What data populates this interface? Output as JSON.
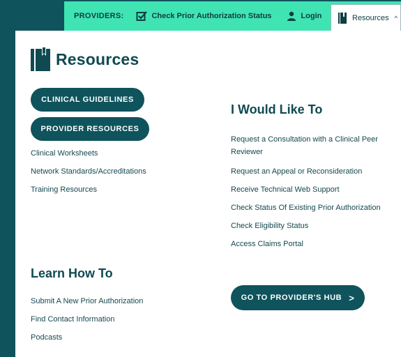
{
  "topbar": {
    "providers_label": "PROVIDERS:",
    "status_link": "Check Prior Authorization Status",
    "login_link": "Login",
    "resources_tab": "Resources",
    "resources_chevron": "^"
  },
  "panel": {
    "title": "Resources",
    "buttons": {
      "clinical_guidelines": "CLINICAL GUIDELINES",
      "provider_resources": "PROVIDER RESOURCES"
    },
    "resource_links": [
      "Clinical Worksheets",
      "Network Standards/Accreditations",
      "Training Resources"
    ],
    "would_like": {
      "heading": "I Would Like To",
      "links": [
        "Request a Consultation with a Clinical Peer Reviewer",
        "Request an Appeal or Reconsideration",
        "Receive Technical Web Support",
        "Check Status Of Existing Prior Authorization",
        "Check Eligibility Status",
        "Access Claims Portal"
      ]
    },
    "learn": {
      "heading": "Learn How To",
      "links": [
        "Submit A New Prior Authorization",
        "Find Contact Information",
        "Podcasts"
      ]
    },
    "hub_button": "GO TO PROVIDER'S HUB",
    "hub_arrow": ">"
  },
  "colors": {
    "teal_dark": "#0f535c",
    "mint": "#3fe4b2",
    "text": "#15484f"
  }
}
